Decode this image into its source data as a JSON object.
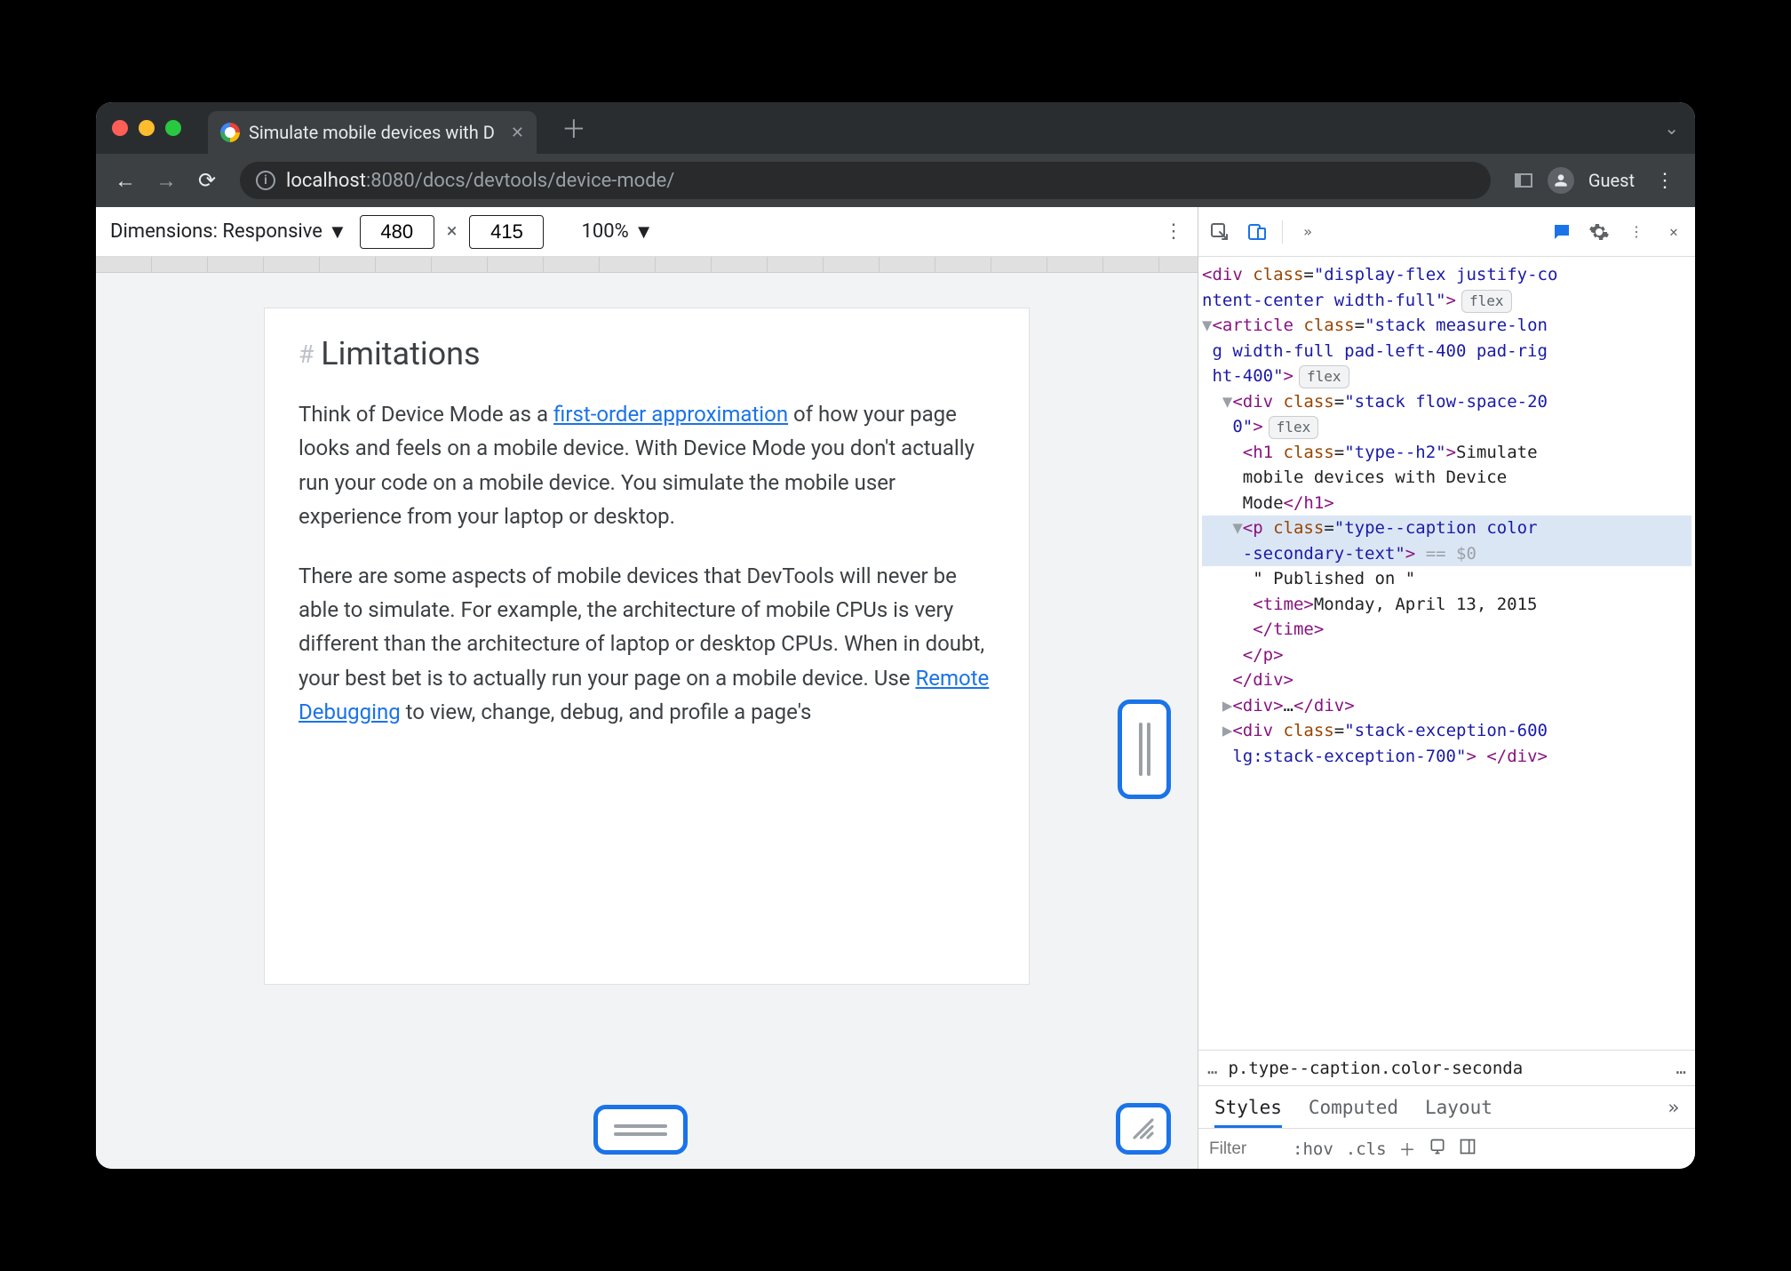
{
  "window": {
    "tab_title": "Simulate mobile devices with D",
    "guest_label": "Guest"
  },
  "omnibox": {
    "host": "localhost",
    "port_and_path": ":8080/docs/devtools/device-mode/"
  },
  "device_bar": {
    "dimensions_label": "Dimensions: Responsive",
    "width": "480",
    "height": "415",
    "separator": "×",
    "zoom": "100%"
  },
  "doc": {
    "heading": "Limitations",
    "hash": "#",
    "p1_a": "Think of Device Mode as a ",
    "p1_link": "first-order approximation",
    "p1_b": " of how your page looks and feels on a mobile device. With Device Mode you don't actually run your code on a mobile device. You simulate the mobile user experience from your laptop or desktop.",
    "p2_a": "There are some aspects of mobile devices that DevTools will never be able to simulate. For example, the architecture of mobile CPUs is very different than the architecture of laptop or desktop CPUs. When in doubt, your best bet is to actually run your page on a mobile device. Use ",
    "p2_link": "Remote Debugging",
    "p2_b": " to view, change, debug, and profile a page's"
  },
  "elements": {
    "l1": "<div class=\"display-flex justify-co",
    "l2": "ntent-center width-full\">",
    "l2_badge": "flex",
    "l3": "▼<article class=\"stack measure-lon",
    "l4": "g width-full pad-left-400 pad-rig",
    "l5": "ht-400\">",
    "l5_badge": "flex",
    "l6": " ▼<div class=\"stack flow-space-20",
    "l7": "0\">",
    "l7_badge": "flex",
    "l8": "   <h1 class=\"type--h2\">Simulate",
    "l9": "   mobile devices with Device",
    "l10": "   Mode</h1>",
    "l11": "  ▼<p class=\"type--caption color",
    "l12": "   -secondary-text\"> == $0",
    "l13": "    \" Published on \"",
    "l14": "    <time>Monday, April 13, 2015",
    "l15": "    </time>",
    "l16": "   </p>",
    "l17": "  </div>",
    "l18": " ▶<div>…</div>",
    "l19": " ▶<div class=\"stack-exception-600",
    "l20": "  lg:stack-exception-700\"> </div>"
  },
  "crumbs": {
    "left": "…",
    "selected": "p.type--caption.color-seconda",
    "right": "…"
  },
  "styles_tabs": {
    "t1": "Styles",
    "t2": "Computed",
    "t3": "Layout"
  },
  "styles_filter": {
    "placeholder": "Filter",
    "hov": ":hov",
    "cls": ".cls"
  }
}
